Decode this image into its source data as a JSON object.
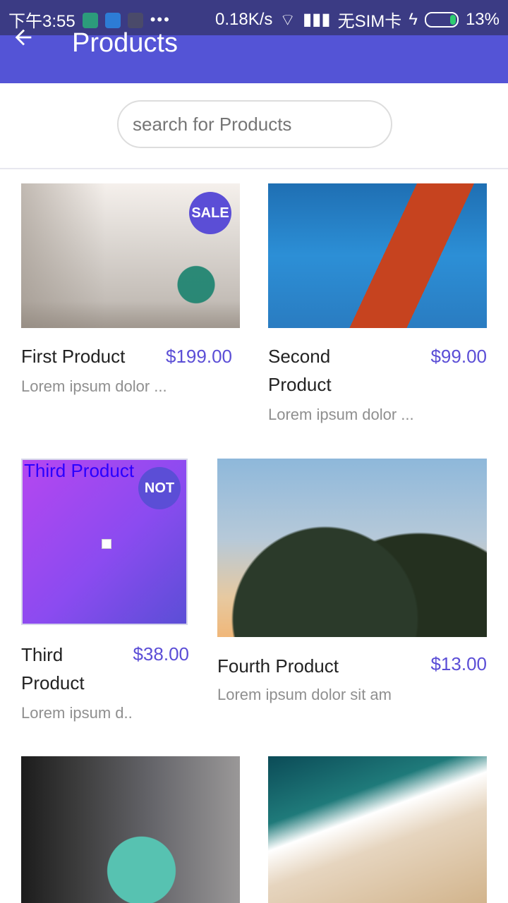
{
  "status_bar": {
    "left_time": "下午3:55",
    "net_speed": "0.18K/s",
    "carrier": "无SIM卡",
    "battery": "13%"
  },
  "app_bar": {
    "title": "Products"
  },
  "search": {
    "placeholder": "search for Products"
  },
  "products": [
    {
      "name": "First Product",
      "price": "$199.00",
      "description": "Lorem ipsum dolor ...",
      "badge": "SALE"
    },
    {
      "name": "Second Product",
      "price": "$99.00",
      "description": "Lorem ipsum dolor ..."
    },
    {
      "name": "Third Product",
      "price": "$38.00",
      "description": "Lorem ipsum d..",
      "badge": "NOT",
      "image_title": "Third Product"
    },
    {
      "name": "Fourth Product",
      "price": "$13.00",
      "description": "Lorem ipsum dolor sit am"
    }
  ],
  "colors": {
    "app_bar": "#5454d6",
    "accent": "#5b4ed6",
    "muted_text": "#8f8f8f"
  },
  "icons": {
    "back": "arrow-left-icon",
    "wifi": "wifi-icon",
    "signal": "signal-icon",
    "battery": "battery-icon"
  }
}
